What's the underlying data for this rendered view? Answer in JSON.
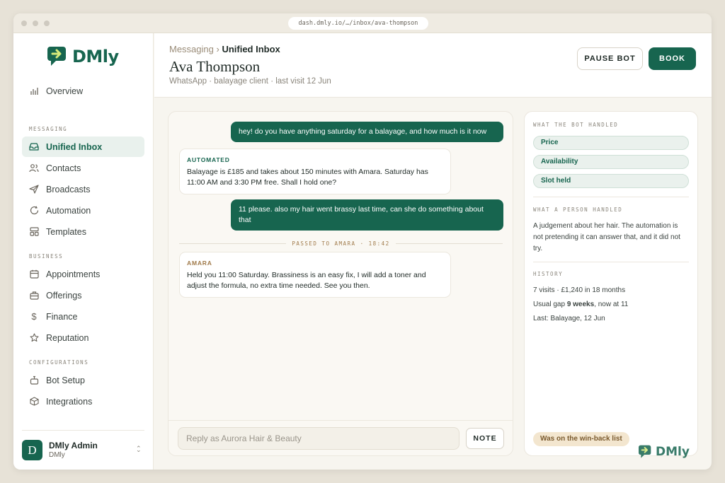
{
  "browser": {
    "url": "dash.dmly.io/…/inbox/ava-thompson"
  },
  "brand": {
    "name": "DMly",
    "color": "#17654f"
  },
  "sidebar": {
    "overview": "Overview",
    "sections": {
      "messaging": "MESSAGING",
      "business": "BUSINESS",
      "configurations": "CONFIGURATIONS"
    },
    "messaging_items": [
      {
        "label": "Unified Inbox",
        "icon": "inbox-icon",
        "active": true
      },
      {
        "label": "Contacts",
        "icon": "users-icon"
      },
      {
        "label": "Broadcasts",
        "icon": "send-icon"
      },
      {
        "label": "Automation",
        "icon": "refresh-icon"
      },
      {
        "label": "Templates",
        "icon": "layout-icon"
      }
    ],
    "business_items": [
      {
        "label": "Appointments",
        "icon": "calendar-icon"
      },
      {
        "label": "Offerings",
        "icon": "briefcase-icon"
      },
      {
        "label": "Finance",
        "icon": "dollar-icon"
      },
      {
        "label": "Reputation",
        "icon": "star-icon"
      }
    ],
    "config_items": [
      {
        "label": "Bot Setup",
        "icon": "bot-icon"
      },
      {
        "label": "Integrations",
        "icon": "cube-icon"
      }
    ],
    "profile": {
      "initial": "D",
      "name": "DMly Admin",
      "org": "DMly"
    }
  },
  "header": {
    "breadcrumb_parent": "Messaging ›",
    "breadcrumb_current": "Unified Inbox",
    "title": "Ava Thompson",
    "subtitle": "WhatsApp · balayage client · last visit 12 Jun",
    "pause_label": "PAUSE BOT",
    "book_label": "BOOK"
  },
  "chat": {
    "messages": [
      {
        "type": "out",
        "text": "hey! do you have anything saturday for a balayage, and how much is it now"
      },
      {
        "type": "in",
        "label": "AUTOMATED",
        "text": "Balayage is £185 and takes about 150 minutes with Amara. Saturday has 11:00 AM and 3:30 PM free. Shall I hold one?"
      },
      {
        "type": "out",
        "text": "11 please. also my hair went brassy last time, can she do something about that"
      },
      {
        "type": "in",
        "label": "AMARA",
        "text": "Held you 11:00 Saturday. Brassiness is an easy fix, I will add a toner and adjust the formula, no extra time needed. See you then."
      }
    ],
    "handoff": "PASSED TO AMARA · 18:42",
    "reply_placeholder": "Reply as Aurora Hair & Beauty",
    "note_label": "NOTE"
  },
  "panel": {
    "bot_heading": "WHAT THE BOT HANDLED",
    "bot_items": [
      "Price",
      "Availability",
      "Slot held"
    ],
    "person_heading": "WHAT A PERSON HANDLED",
    "person_text": "A judgement about her hair. The automation is not pretending it can answer that, and it did not try.",
    "history_heading": "HISTORY",
    "history": {
      "visits": "7 visits · £1,240 in 18 months",
      "gap_prefix": "Usual gap ",
      "gap_bold": "9 weeks",
      "gap_suffix": ", now at 11",
      "last": "Last: Balayage, 12 Jun"
    },
    "winback": "Was on the win-back list"
  }
}
